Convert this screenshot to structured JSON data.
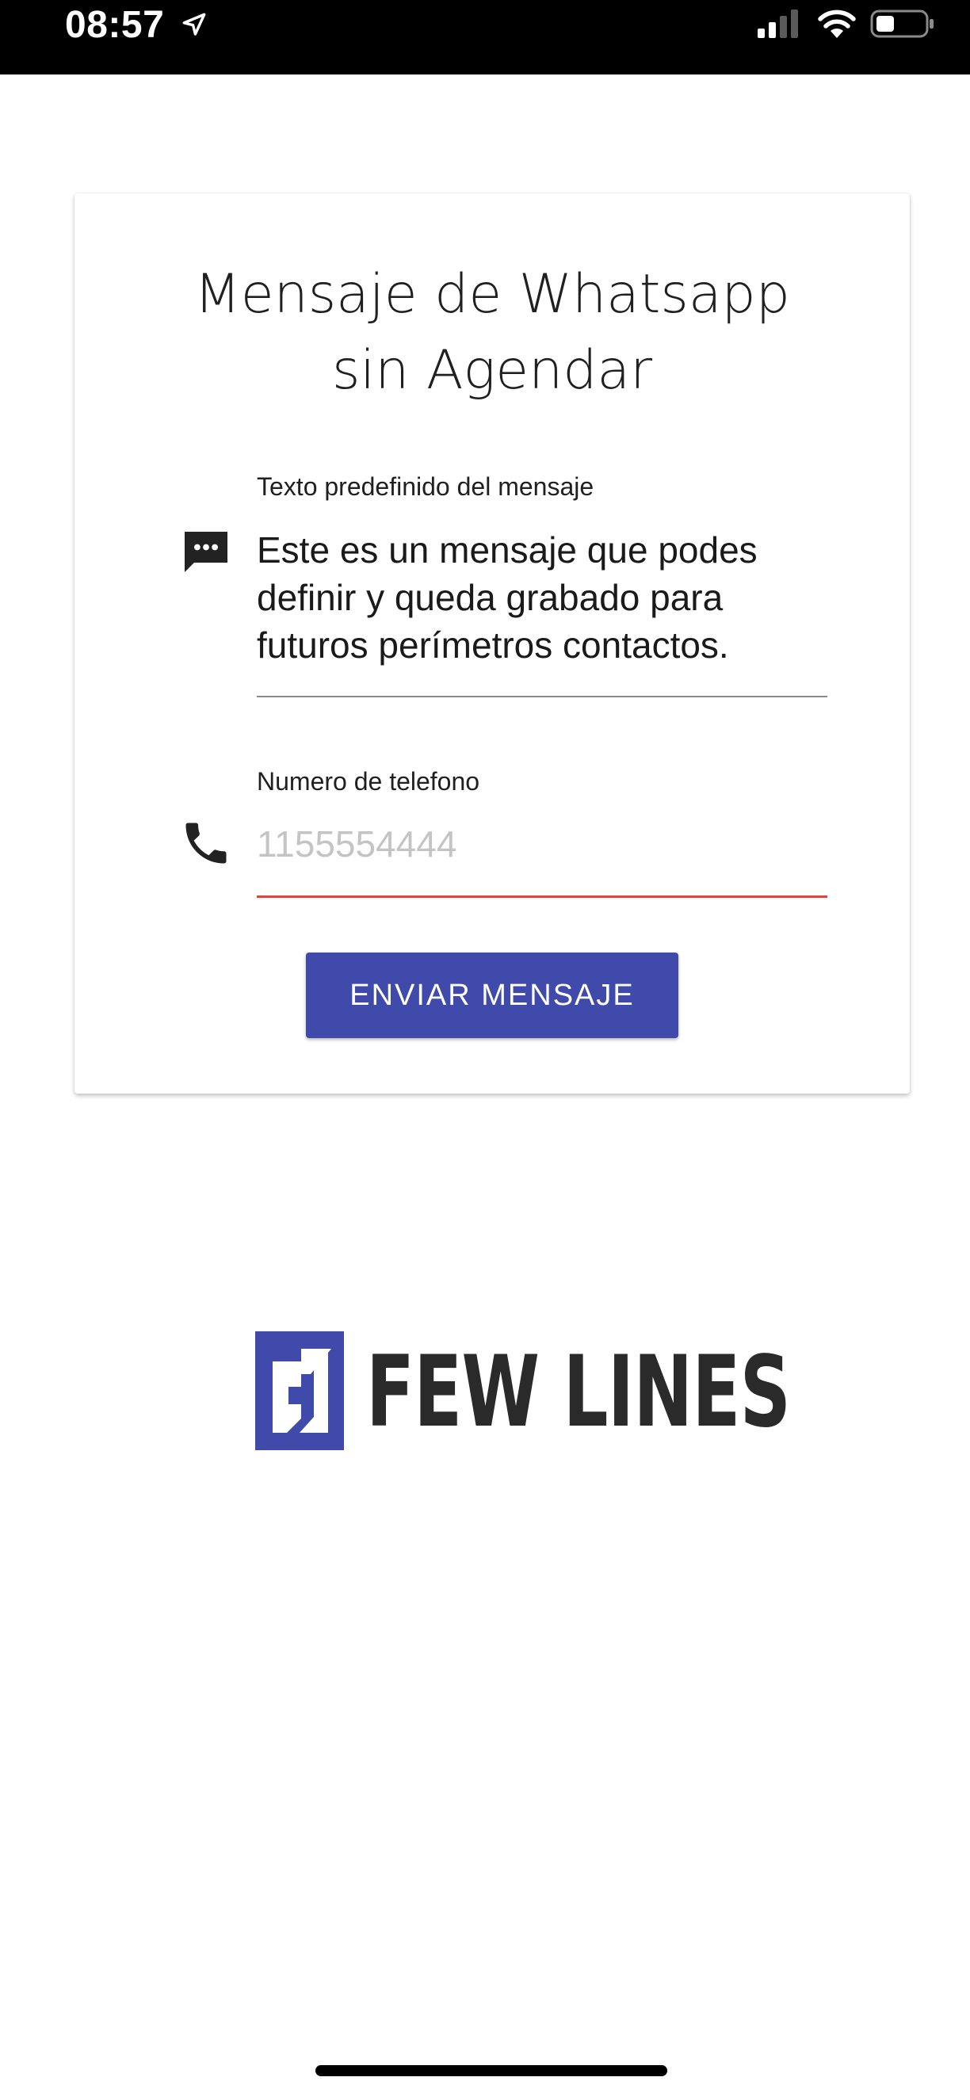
{
  "status_bar": {
    "time": "08:57",
    "location_icon": "location-arrow-icon",
    "signal_icon": "cellular-signal-icon",
    "wifi_icon": "wifi-icon",
    "battery_icon": "battery-icon"
  },
  "form": {
    "title_line1": "Mensaje de Whatsapp",
    "title_line2": "sin Agendar",
    "message_label": "Texto predefinido del mensaje",
    "message_value": "Este es un mensaje que podes definir y queda grabado para futuros perímetros contactos.",
    "message_icon": "chat-bubble-icon",
    "phone_label": "Numero de telefono",
    "phone_placeholder": "1155554444",
    "phone_value": "",
    "phone_icon": "phone-icon",
    "send_button": "ENVIAR MENSAJE"
  },
  "brand": {
    "name": "FEW LINES",
    "accent_color": "#3f4aaa",
    "error_color": "#e0453a"
  }
}
